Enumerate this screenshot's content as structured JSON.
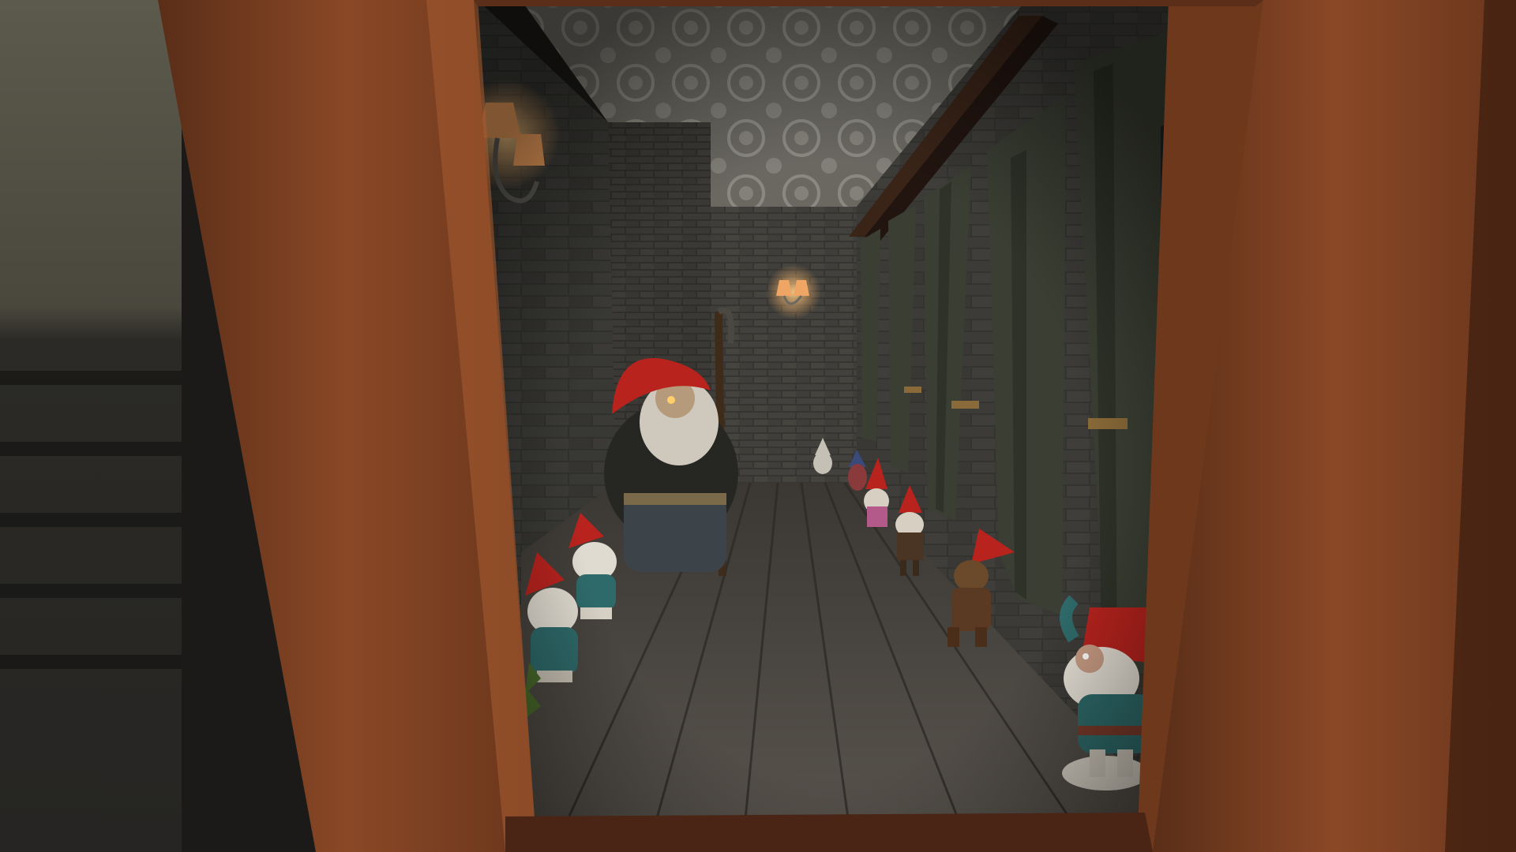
{
  "scene": {
    "type": "game-screenshot",
    "description_colors": {
      "door_frame": "#7a3f22",
      "door_frame_dark": "#4a2414",
      "brick_wall": "#3b3a37",
      "floor": "#4a4640",
      "ceiling": "#8c8a82",
      "gnome_hat": "#b8231e",
      "curtain": "#3c4034",
      "lamp_glow": "#f4b36a"
    },
    "icons": [
      "door-frame",
      "wall-sconce",
      "garden-gnome",
      "curtain"
    ]
  }
}
